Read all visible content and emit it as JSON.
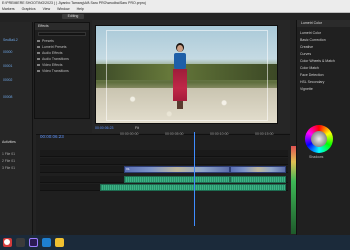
{
  "window": {
    "title": "E:\\PREMIERE SHOOTING\\2023 ( ) Jiyanbo Tamang\\All\\ Saru PRO\\seudba\\Saru PRO.prproj"
  },
  "menubar": [
    "Markers",
    "Graphics",
    "View",
    "Window",
    "Help"
  ],
  "top_tab": "Editing",
  "left_panel": {
    "rows": [
      {
        "label": "SeuBaiL2"
      },
      {
        "label": "00000"
      },
      {
        "label": "00001"
      },
      {
        "label": "00002"
      },
      {
        "label": "00008"
      }
    ]
  },
  "effects_panel": {
    "title": "Effects",
    "items": [
      "Presets",
      "Lumetri Presets",
      "Audio Effects",
      "Audio Transitions",
      "Video Effects",
      "Video Transitions"
    ]
  },
  "program": {
    "timecode": "00:00:06:23",
    "fit": "Fit"
  },
  "timeline": {
    "timecode": "00:00:06:23",
    "ruler": [
      "00:00:00:00",
      "00:00:05:00",
      "00:00:10:00",
      "00:00:15:00"
    ],
    "clip_label": "V1"
  },
  "left_bottom": {
    "label": "Activities",
    "rows": [
      "1 File 01",
      "2 File 01",
      "3 File 01"
    ]
  },
  "lumetri": {
    "tabs": [
      "Lumetri Color"
    ],
    "subtitle": "Lumetri Color",
    "sections": [
      "Basic Correction",
      "Creative",
      "Curves",
      "Color Wheels & Match",
      "Color Match",
      "Face Detection",
      "HSL Secondary",
      "Vignette"
    ],
    "wheel_label": "Shadows"
  },
  "taskbar": {
    "items": [
      "start",
      "search",
      "premiere",
      "edge",
      "explorer",
      "files"
    ]
  },
  "colors": {
    "accent": "#3f8cff",
    "timecode": "#5f95ff",
    "clip_video": "#7d93c7",
    "clip_audio": "#3ab384"
  }
}
